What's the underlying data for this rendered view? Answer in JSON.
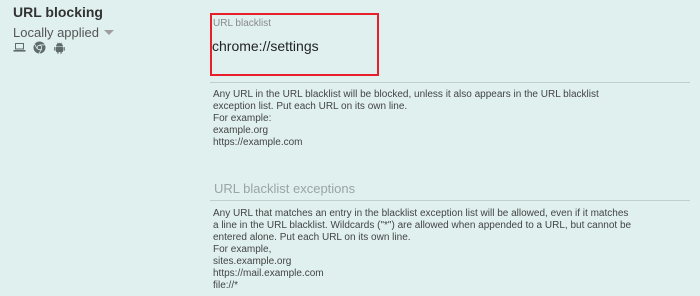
{
  "setting": {
    "title": "URL blocking",
    "scope_label": "Locally applied",
    "platform_icons": [
      "laptop-icon",
      "chrome-icon",
      "android-icon"
    ]
  },
  "blacklist": {
    "label": "URL blacklist",
    "value": "chrome://settings",
    "description_lines": [
      "Any URL in the URL blacklist will be blocked, unless it also appears in the URL blacklist",
      "exception list. Put each URL on its own line.",
      "For example:",
      "example.org",
      "https://example.com"
    ]
  },
  "exceptions": {
    "title": "URL blacklist exceptions",
    "description_lines": [
      "Any URL that matches an entry in the blacklist exception list will be allowed, even if it matches",
      "a line in the URL blacklist. Wildcards (\"*\") are allowed when appended to a URL, but cannot be",
      "entered alone. Put each URL on its own line.",
      "For example,",
      "sites.example.org",
      "https://mail.example.com",
      "file://*"
    ]
  },
  "colors": {
    "background": "#dff0ef",
    "highlight_border": "#e8202a"
  }
}
